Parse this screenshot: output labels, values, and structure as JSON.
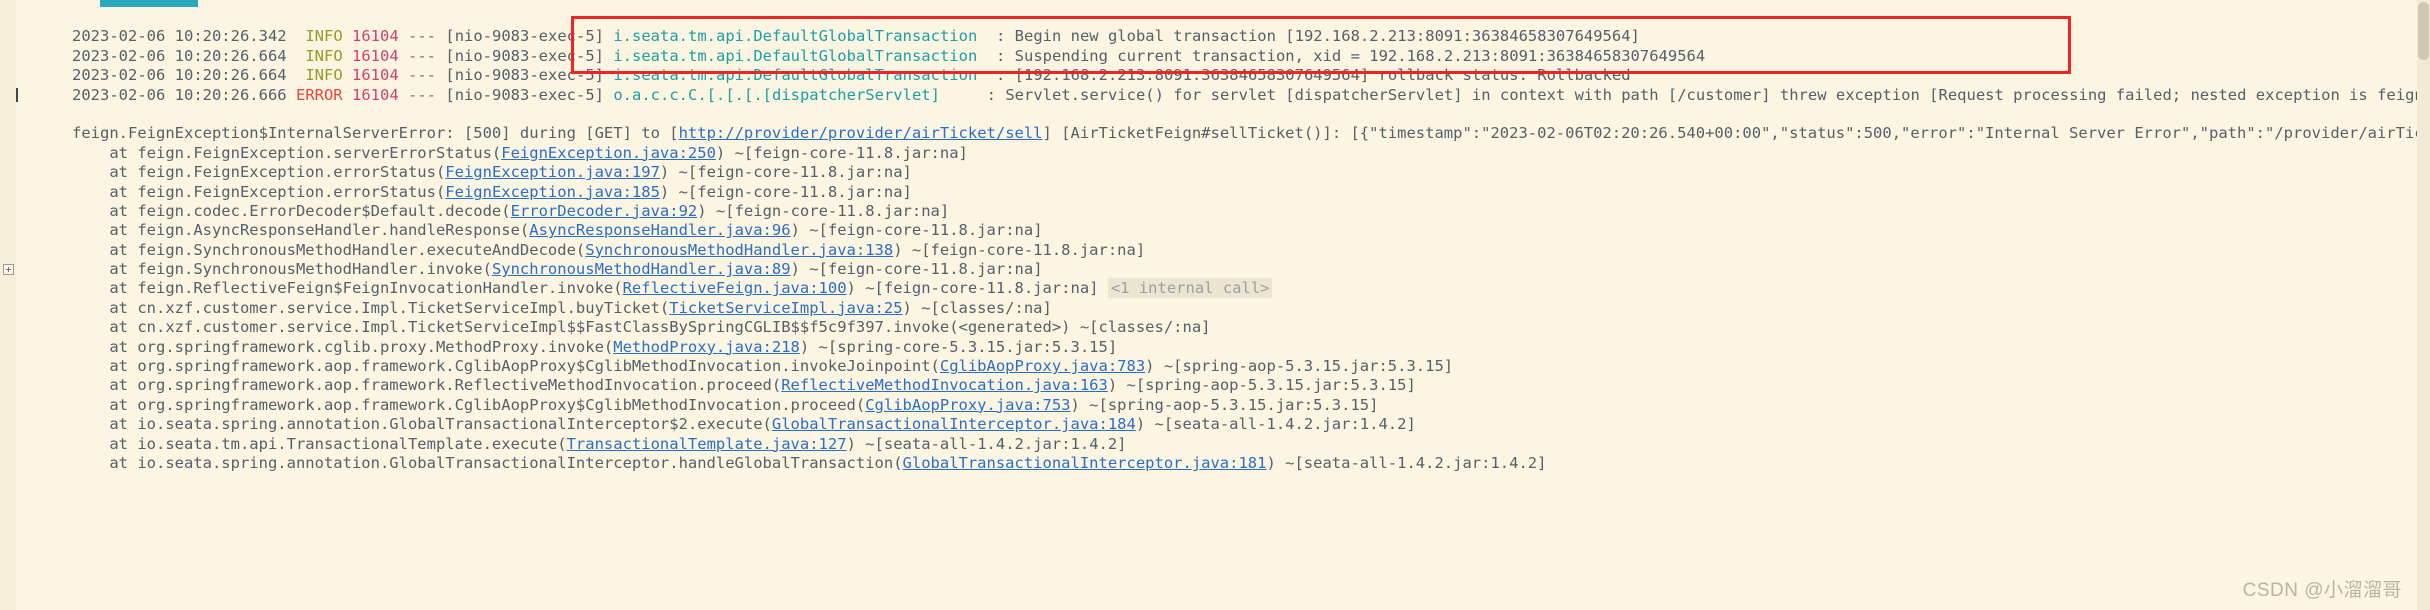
{
  "console": {
    "background_color": "#fbf5e2",
    "tab_marker_color": "#2aa8bd",
    "annotation_color": "#ef2525"
  },
  "colors": {
    "info_level": "#9a9b24",
    "error_level": "#e8453c",
    "pid": "#d3416f",
    "logger": "#1ba0a5",
    "link": "#2a6ec9",
    "text": "#55606b"
  },
  "watermark": {
    "text": "CSDN @小溜溜哥"
  },
  "log_lines": [
    {
      "timestamp": "2023-02-06 10:20:26.342",
      "level": "INFO",
      "pid": "16104",
      "sep": "---",
      "thread": "[nio-9083-exec-5]",
      "logger": "i.seata.tm.api.DefaultGlobalTransaction",
      "colon": ":",
      "message": "Begin new global transaction [192.168.2.213:8091:36384658307649564]"
    },
    {
      "timestamp": "2023-02-06 10:20:26.664",
      "level": "INFO",
      "pid": "16104",
      "sep": "---",
      "thread": "[nio-9083-exec-5]",
      "logger": "i.seata.tm.api.DefaultGlobalTransaction",
      "colon": ":",
      "message": "Suspending current transaction, xid = 192.168.2.213:8091:36384658307649564"
    },
    {
      "timestamp": "2023-02-06 10:20:26.664",
      "level": "INFO",
      "pid": "16104",
      "sep": "---",
      "thread": "[nio-9083-exec-5]",
      "logger": "i.seata.tm.api.DefaultGlobalTransaction",
      "colon": ":",
      "message": "[192.168.2.213:8091:36384658307649564] rollback status: Rollbacked"
    },
    {
      "timestamp": "2023-02-06 10:20:26.666",
      "level": "ERROR",
      "pid": "16104",
      "sep": "---",
      "thread": "[nio-9083-exec-5]",
      "logger": "o.a.c.c.C.[.[.[.[dispatcherServlet]",
      "colon": ":",
      "message": "Servlet.service() for servlet [dispatcherServlet] in context with path [/customer] threw exception [Request processing failed; nested exception is feign.FeignExceptio"
    }
  ],
  "exception": {
    "header_pre": "feign.FeignException$InternalServerError: [500] during [GET] to [",
    "header_link": "http://provider/provider/airTicket/sell",
    "header_post": "] [AirTicketFeign#sellTicket()]: [{\"timestamp\":\"2023-02-06T02:20:26.540+00:00\",\"status\":500,\"error\":\"Internal Server Error\",\"path\":\"/provider/airTicket/sell\"}]"
  },
  "stack_frames": [
    {
      "pre": "    at feign.FeignException.serverErrorStatus(",
      "link": "FeignException.java:250",
      "post": ") ~[feign-core-11.8.jar:na]",
      "expandable": false,
      "internal": ""
    },
    {
      "pre": "    at feign.FeignException.errorStatus(",
      "link": "FeignException.java:197",
      "post": ") ~[feign-core-11.8.jar:na]",
      "expandable": false,
      "internal": ""
    },
    {
      "pre": "    at feign.FeignException.errorStatus(",
      "link": "FeignException.java:185",
      "post": ") ~[feign-core-11.8.jar:na]",
      "expandable": false,
      "internal": ""
    },
    {
      "pre": "    at feign.codec.ErrorDecoder$Default.decode(",
      "link": "ErrorDecoder.java:92",
      "post": ") ~[feign-core-11.8.jar:na]",
      "expandable": false,
      "internal": ""
    },
    {
      "pre": "    at feign.AsyncResponseHandler.handleResponse(",
      "link": "AsyncResponseHandler.java:96",
      "post": ") ~[feign-core-11.8.jar:na]",
      "expandable": false,
      "internal": ""
    },
    {
      "pre": "    at feign.SynchronousMethodHandler.executeAndDecode(",
      "link": "SynchronousMethodHandler.java:138",
      "post": ") ~[feign-core-11.8.jar:na]",
      "expandable": false,
      "internal": ""
    },
    {
      "pre": "    at feign.SynchronousMethodHandler.invoke(",
      "link": "SynchronousMethodHandler.java:89",
      "post": ") ~[feign-core-11.8.jar:na]",
      "expandable": false,
      "internal": ""
    },
    {
      "pre": "    at feign.ReflectiveFeign$FeignInvocationHandler.invoke(",
      "link": "ReflectiveFeign.java:100",
      "post": ") ~[feign-core-11.8.jar:na] ",
      "expandable": true,
      "internal": "<1 internal call>"
    },
    {
      "pre": "    at cn.xzf.customer.service.Impl.TicketServiceImpl.buyTicket(",
      "link": "TicketServiceImpl.java:25",
      "post": ") ~[classes/:na]",
      "expandable": false,
      "internal": ""
    },
    {
      "pre": "    at cn.xzf.customer.service.Impl.TicketServiceImpl$$FastClassBySpringCGLIB$$f5c9f397.invoke(<generated>) ~[classes/:na]",
      "link": "",
      "post": "",
      "expandable": false,
      "internal": ""
    },
    {
      "pre": "    at org.springframework.cglib.proxy.MethodProxy.invoke(",
      "link": "MethodProxy.java:218",
      "post": ") ~[spring-core-5.3.15.jar:5.3.15]",
      "expandable": false,
      "internal": ""
    },
    {
      "pre": "    at org.springframework.aop.framework.CglibAopProxy$CglibMethodInvocation.invokeJoinpoint(",
      "link": "CglibAopProxy.java:783",
      "post": ") ~[spring-aop-5.3.15.jar:5.3.15]",
      "expandable": false,
      "internal": ""
    },
    {
      "pre": "    at org.springframework.aop.framework.ReflectiveMethodInvocation.proceed(",
      "link": "ReflectiveMethodInvocation.java:163",
      "post": ") ~[spring-aop-5.3.15.jar:5.3.15]",
      "expandable": false,
      "internal": ""
    },
    {
      "pre": "    at org.springframework.aop.framework.CglibAopProxy$CglibMethodInvocation.proceed(",
      "link": "CglibAopProxy.java:753",
      "post": ") ~[spring-aop-5.3.15.jar:5.3.15]",
      "expandable": false,
      "internal": ""
    },
    {
      "pre": "    at io.seata.spring.annotation.GlobalTransactionalInterceptor$2.execute(",
      "link": "GlobalTransactionalInterceptor.java:184",
      "post": ") ~[seata-all-1.4.2.jar:1.4.2]",
      "expandable": false,
      "internal": ""
    },
    {
      "pre": "    at io.seata.tm.api.TransactionalTemplate.execute(",
      "link": "TransactionalTemplate.java:127",
      "post": ") ~[seata-all-1.4.2.jar:1.4.2]",
      "expandable": false,
      "internal": ""
    },
    {
      "pre": "    at io.seata.spring.annotation.GlobalTransactionalInterceptor.handleGlobalTransaction(",
      "link": "GlobalTransactionalInterceptor.java:181",
      "post": ") ~[seata-all-1.4.2.jar:1.4.2]",
      "expandable": false,
      "internal": ""
    }
  ]
}
